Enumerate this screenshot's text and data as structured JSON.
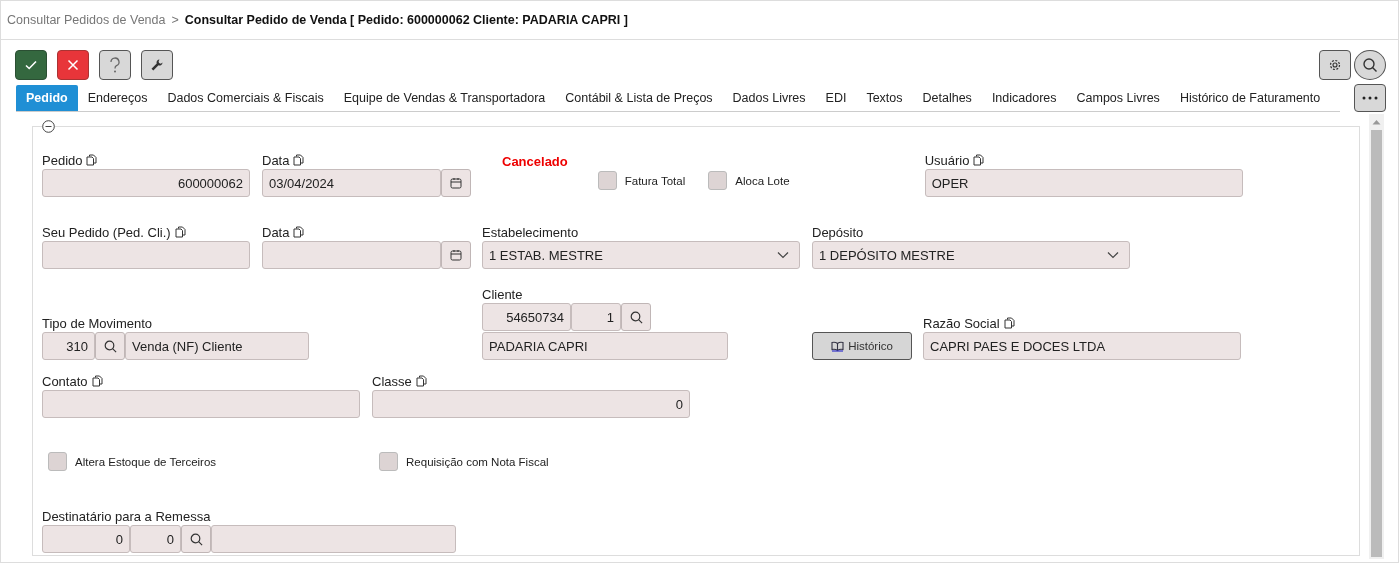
{
  "breadcrumb": {
    "parent": "Consultar Pedidos de Venda",
    "separator": ">",
    "current": "Consultar Pedido de Venda [ Pedido: 600000062 Cliente: PADARIA CAPRI ]"
  },
  "tabs": [
    {
      "label": "Pedido",
      "selected": true
    },
    {
      "label": "Endereços",
      "selected": false
    },
    {
      "label": "Dados Comerciais & Fiscais",
      "selected": false
    },
    {
      "label": "Equipe de Vendas & Transportadora",
      "selected": false
    },
    {
      "label": "Contábil & Lista de Preços",
      "selected": false
    },
    {
      "label": "Dados Livres",
      "selected": false
    },
    {
      "label": "EDI",
      "selected": false
    },
    {
      "label": "Textos",
      "selected": false
    },
    {
      "label": "Detalhes",
      "selected": false
    },
    {
      "label": "Indicadores",
      "selected": false
    },
    {
      "label": "Campos Livres",
      "selected": false
    },
    {
      "label": "Histórico de Faturamento",
      "selected": false
    }
  ],
  "form": {
    "pedido": {
      "label": "Pedido",
      "copy": true,
      "value": "600000062"
    },
    "data": {
      "label": "Data",
      "copy": true,
      "value": "03/04/2024"
    },
    "status": "Cancelado",
    "options_top": [
      {
        "label": "Fatura Total",
        "checked": false
      },
      {
        "label": "Aloca Lote",
        "checked": false
      }
    ],
    "usuario": {
      "label": "Usuário",
      "copy": true,
      "value": "OPER"
    },
    "seu_pedido": {
      "label": "Seu Pedido (Ped. Cli.)",
      "copy": true
    },
    "data_cliente": {
      "label": "Data",
      "copy": true
    },
    "estabelecimento": {
      "label": "Estabelecimento",
      "copy": false,
      "value": "1 ESTAB. MESTRE"
    },
    "deposito": {
      "label": "Depósito",
      "copy": false,
      "value": "1 DEPÓSITO MESTRE"
    },
    "tipo_movimento": {
      "label": "Tipo de Movimento",
      "copy": false,
      "code": "310",
      "value": "Venda (NF) Cliente"
    },
    "cliente": {
      "label": "Cliente",
      "copy": false,
      "code": "54650734",
      "branch": "1",
      "value": "PADARIA CAPRI"
    },
    "historico_button": "Histórico",
    "razao_social": {
      "label": "Razão Social",
      "copy": true,
      "value": "CAPRI PAES E DOCES LTDA"
    },
    "contato": {
      "label": "Contato",
      "copy": true
    },
    "classe": {
      "label": "Classe",
      "copy": true,
      "value": "0"
    },
    "options_bottom": [
      {
        "label": "Altera Estoque de Terceiros",
        "checked": false
      },
      {
        "label": "Requisição com Nota Fiscal",
        "checked": false
      }
    ],
    "destinatario": {
      "label": "Destinatário para a Remessa",
      "copy": false,
      "code": "0",
      "branch": "0"
    }
  }
}
